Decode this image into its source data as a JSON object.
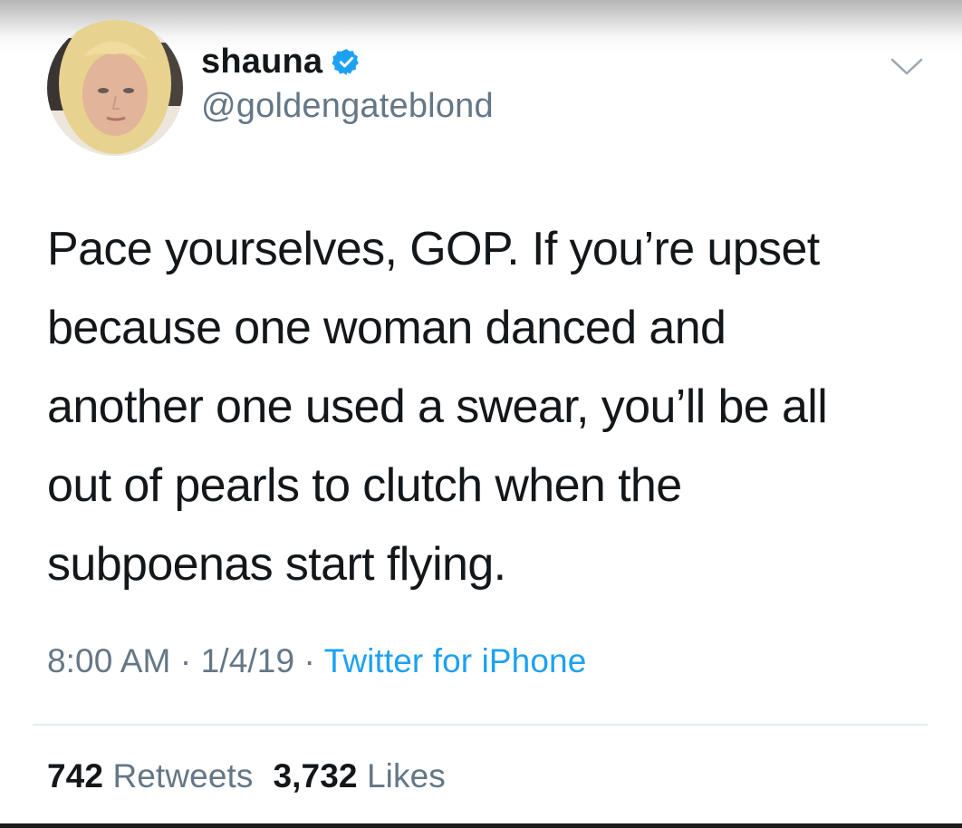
{
  "user": {
    "display_name": "shauna",
    "handle": "@goldengateblond",
    "verified": true
  },
  "tweet": {
    "lines": [
      "Pace yourselves, GOP. If you’re upset",
      "because one woman danced and",
      "another one used a swear, you’ll be all",
      "out of pearls to clutch when the",
      "subpoenas start flying."
    ]
  },
  "meta": {
    "time": "8:00 AM",
    "separator": "·",
    "date": "1/4/19",
    "source": "Twitter for iPhone"
  },
  "stats": {
    "retweets_count": "742",
    "retweets_label": "Retweets",
    "likes_count": "3,732",
    "likes_label": "Likes"
  },
  "icons": {
    "verified": "verified-badge-icon",
    "menu": "chevron-down-icon"
  },
  "colors": {
    "text": "#14171a",
    "secondary": "#657786",
    "link": "#1da1f2",
    "verified": "#1da1f2",
    "divider": "#e6ecf0"
  }
}
